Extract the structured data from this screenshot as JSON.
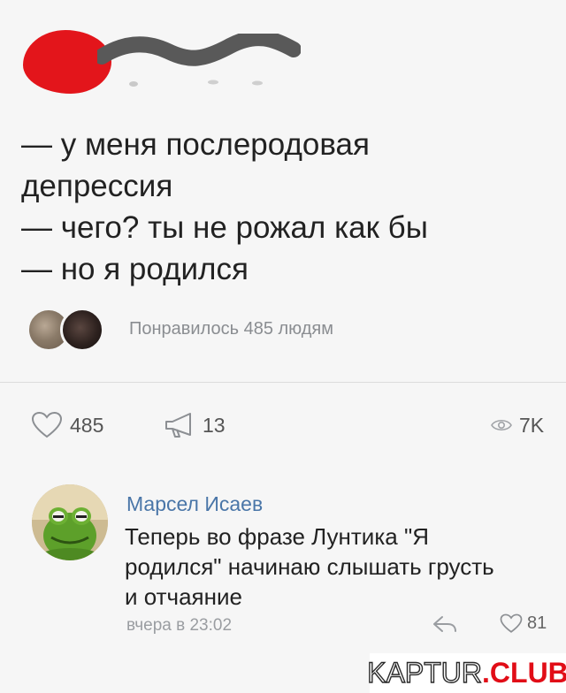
{
  "post": {
    "lines": [
      "— у меня послеродовая",
      "депрессия",
      "— чего? ты не рожал как бы",
      "— но я родился"
    ],
    "likers_text": "Понравилось 485 людям"
  },
  "actions": {
    "likes": "485",
    "shares": "13",
    "views": "7K"
  },
  "comment": {
    "author": "Марсел Исаев",
    "lines": [
      "Теперь во фразе Лунтика \"Я",
      "родился\" начинаю слышать грусть",
      "и отчаяние"
    ],
    "time": "вчера в 23:02",
    "likes": "81"
  },
  "watermark": {
    "part1": "KAPTUR",
    "part2": ".CLUB"
  },
  "colors": {
    "redaction": "#e3151b",
    "link": "#4a76a8",
    "muted": "#8a8d91",
    "brand_red": "#e10d17"
  }
}
